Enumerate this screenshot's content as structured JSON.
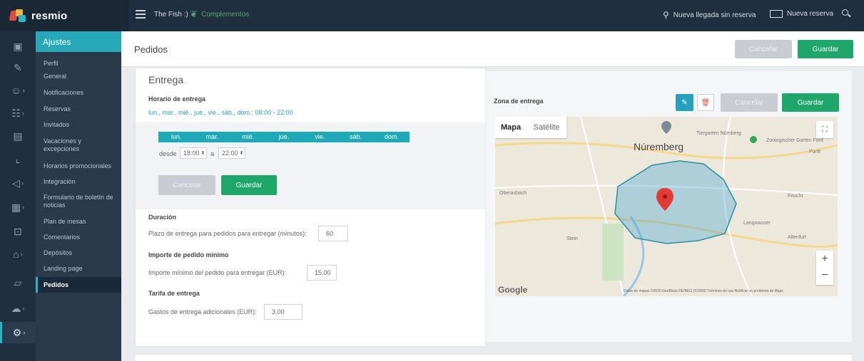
{
  "app": {
    "logo": "resmio"
  },
  "topbar": {
    "venue": "The Fish :)",
    "complements": "Complementos",
    "walkin": "Nueva llegada sin reserva",
    "new_reservation": "Nueva reserva"
  },
  "rail": {
    "icons": [
      "calendar-icon",
      "pen-icon",
      "guests-icon",
      "orders-icon",
      "messages-icon",
      "stats-icon",
      "marketing-icon",
      "reports-icon",
      "table-icon",
      "gift-icon",
      "docs-icon",
      "cloud-icon",
      "settings-icon"
    ]
  },
  "submenu": {
    "header": "Ajustes",
    "items": [
      "Perfil",
      "General",
      "Notificaciones",
      "Reservas",
      "Invitados",
      "Vacaciones y",
      "excepciones",
      "Horarios promocionales",
      "Integración",
      "Formulario de boletín de",
      "noticias",
      "Plan de mesas",
      "Comentarios",
      "Depósitos",
      "Landing page",
      "Pedidos"
    ]
  },
  "page": {
    "title": "Pedidos",
    "cancel": "Cancelar",
    "save": "Guardar"
  },
  "delivery": {
    "title": "Entrega",
    "schedule_label": "Horario de entrega",
    "schedule_summary": "lun., mar., mié., jue., vie., sáb., dom.: 08:00 - 22:00",
    "days": [
      "lun.",
      "mar.",
      "mié.",
      "jue.",
      "vie.",
      "sáb.",
      "dom."
    ],
    "from_label": "desde",
    "from_value": "18:00",
    "to_label": "a",
    "to_value": "22:00",
    "cancel": "Cancelar",
    "save": "Guardar",
    "duration_label": "Duración",
    "duration_text": "Plazo de entrega para pedidos para entregar (minutos):",
    "duration_value": "60",
    "min_label": "Importe de pedido mínimo",
    "min_text": "Importe mínimo del pedido para entregar (EUR):",
    "min_value": "15,00",
    "fee_label": "Tarifa de entrega",
    "fee_text": "Gastos de entrega adicionales (EUR):",
    "fee_value": "3,00"
  },
  "zone": {
    "label": "Zona de entrega",
    "cancel": "Cancelar",
    "save": "Guardar",
    "map_tab": "Mapa",
    "satellite_tab": "Satélite",
    "city": "Núremberg",
    "places": [
      "Tiergarten Nürnberg",
      "Zoologischer Garten Ford",
      "Fürth",
      "Oberasbach",
      "Stein",
      "Feucht",
      "Langwasser",
      "Altenfurt"
    ],
    "google": "Google",
    "attribution": "Datos de mapas ©2020 GeoBasis-DE/BKG (©2009)   Términos de uso   Notificar un problema de Maps",
    "colors": {
      "accent": "#27b6c7",
      "save": "#1fa66b",
      "polygon": "#2a8fa4",
      "marker": "#e53935"
    }
  }
}
